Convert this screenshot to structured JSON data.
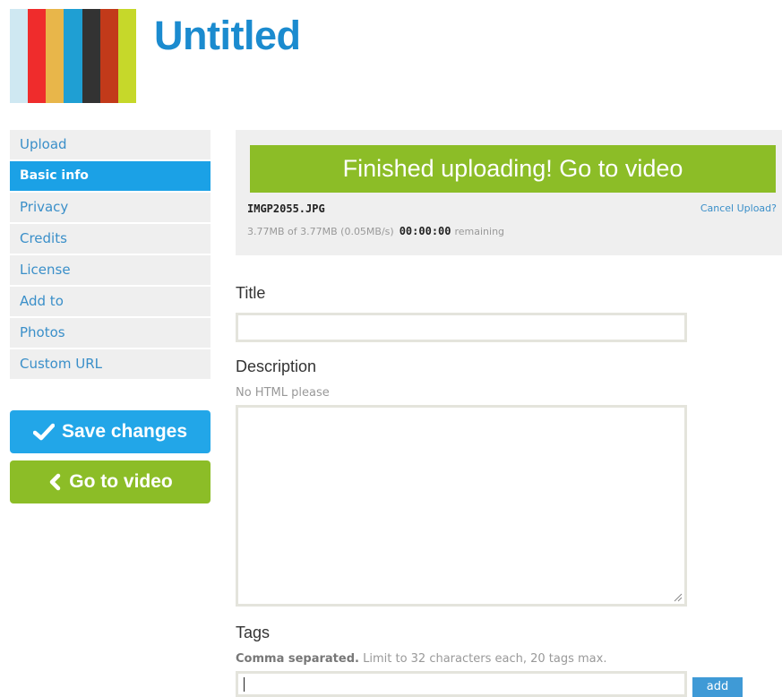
{
  "page": {
    "title": "Untitled"
  },
  "thumbnail": {
    "stripes": [
      "#cfe8f2",
      "#ef2c2c",
      "#e8b64a",
      "#1f9fd3",
      "#333333",
      "#c23a1a",
      "#c6d82a"
    ]
  },
  "nav": {
    "items": [
      {
        "label": "Upload"
      },
      {
        "label": "Basic info",
        "active": true
      },
      {
        "label": "Privacy"
      },
      {
        "label": "Credits"
      },
      {
        "label": "License"
      },
      {
        "label": "Add to"
      },
      {
        "label": "Photos"
      },
      {
        "label": "Custom URL"
      }
    ]
  },
  "buttons": {
    "save_label": "Save changes",
    "go_label": "Go to video"
  },
  "upload": {
    "banner": "Finished uploading! Go to video",
    "filename": "IMGP2055.JPG",
    "cancel": "Cancel Upload?",
    "progress": "3.77MB of 3.77MB (0.05MB/s)",
    "time": "00:00:00",
    "remaining": "remaining"
  },
  "form": {
    "title_label": "Title",
    "title_value": "",
    "desc_label": "Description",
    "desc_hint": "No HTML please",
    "desc_value": "",
    "tags_label": "Tags",
    "tags_hint_bold": "Comma separated.",
    "tags_hint": "Limit to 32 characters each, 20 tags max.",
    "tags_value": "",
    "add_label": "add"
  },
  "colors": {
    "accent_blue": "#1ba1e6",
    "accent_green": "#8cbd27",
    "title_blue": "#1b8bcf"
  }
}
